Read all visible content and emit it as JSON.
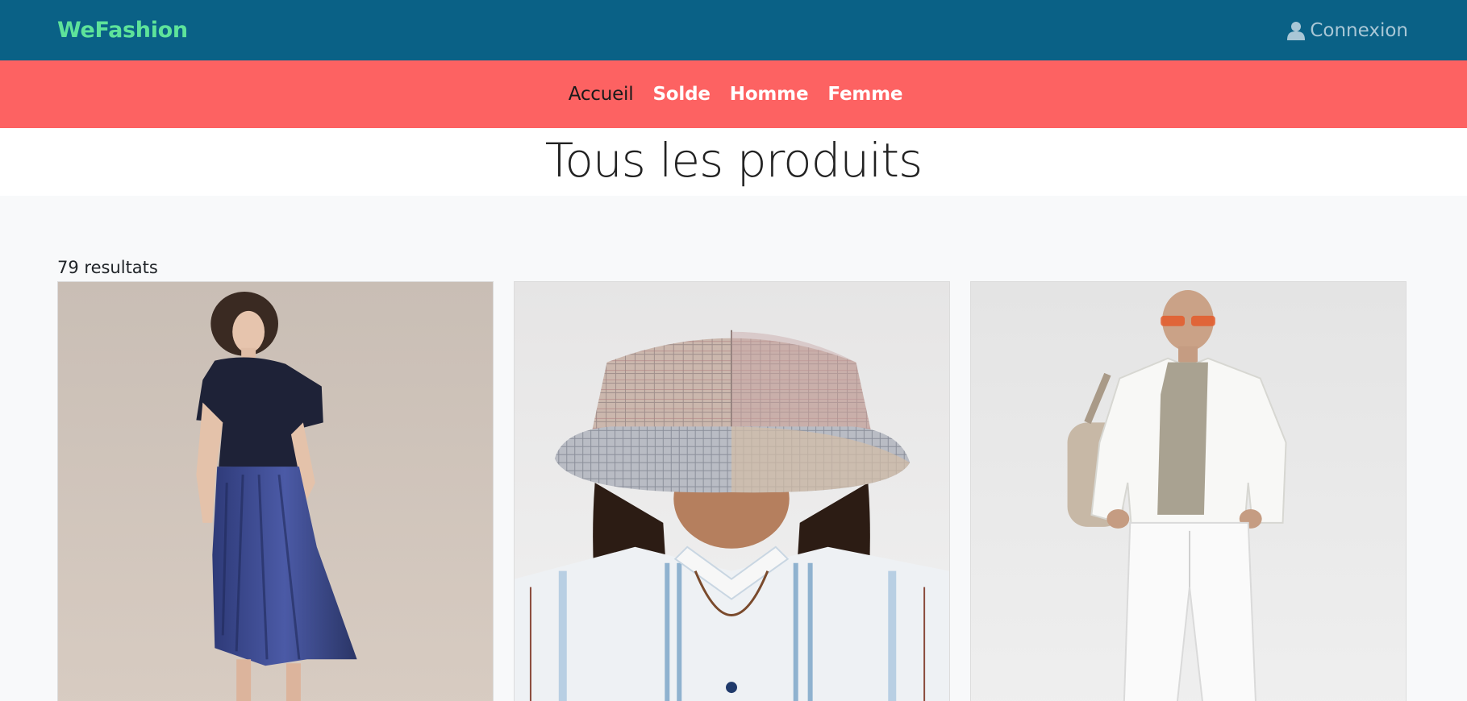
{
  "header": {
    "brand": "WeFashion",
    "login_label": "Connexion",
    "login_icon": "user-icon"
  },
  "nav": {
    "items": [
      {
        "label": "Accueil",
        "active": true
      },
      {
        "label": "Solde",
        "active": false
      },
      {
        "label": "Homme",
        "active": false
      },
      {
        "label": "Femme",
        "active": false
      }
    ]
  },
  "page": {
    "title": "Tous les produits",
    "results_count": "79 resultats"
  },
  "colors": {
    "topbar": "#0a6186",
    "brand": "#5ee39a",
    "nav_bg": "#fd6262",
    "page_bg": "#f8f9fa"
  },
  "products": [
    {
      "image": "woman-velvet-top-pleated-skirt"
    },
    {
      "image": "bucket-hat-striped-shirt"
    },
    {
      "image": "man-white-jacket-white-jeans"
    }
  ]
}
